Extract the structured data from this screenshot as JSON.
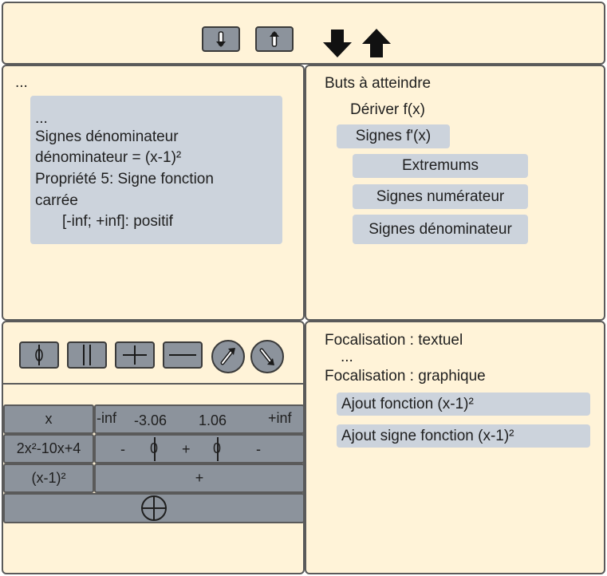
{
  "proof": {
    "ellipsis": "...",
    "card_lines": [
      "...",
      "Signes dénominateur",
      "dénominateur = (x-1)²",
      "Propriété 5: Signe fonction",
      "carrée",
      "[-inf; +inf]: positif"
    ]
  },
  "goals": {
    "title": "Buts à atteindre",
    "derive": "Dériver f(x)",
    "signes_fprime": "Signes f'(x)",
    "extremums": "Extremums",
    "signes_num": "Signes numérateur",
    "signes_den": "Signes dénominateur"
  },
  "table": {
    "row_x": {
      "label": "x",
      "values": [
        "-inf",
        "-3.06",
        "1.06",
        "+inf"
      ]
    },
    "row_poly": {
      "label": "2x²-10x+4",
      "signs": [
        "-",
        "0",
        "+",
        "0",
        "-"
      ]
    },
    "row_sq": {
      "label": "(x-1)²",
      "sign": "+"
    }
  },
  "focus": {
    "textuel": "Focalisation : textuel",
    "ellipsis": "...",
    "graphique": "Focalisation : graphique",
    "item1": "Ajout fonction (x-1)²",
    "item2": "Ajout signe fonction (x-1)²"
  },
  "icons": {
    "top_buttons": [
      "down-arrow-icon",
      "up-arrow-icon"
    ],
    "top_big_arrows": [
      "big-down-arrow-icon",
      "big-up-arrow-icon"
    ],
    "table_tools": [
      "zero-marker-icon",
      "double-bar-icon",
      "plus-sign-icon",
      "minus-sign-icon",
      "arrow-up-right-icon",
      "arrow-down-right-icon"
    ],
    "add_row": "circled-plus-icon"
  },
  "colors": {
    "panel_bg": "#fff3d8",
    "card_bg": "#ccd3dc",
    "tool_bg": "#8c939c",
    "border": "#5a5a5a"
  }
}
